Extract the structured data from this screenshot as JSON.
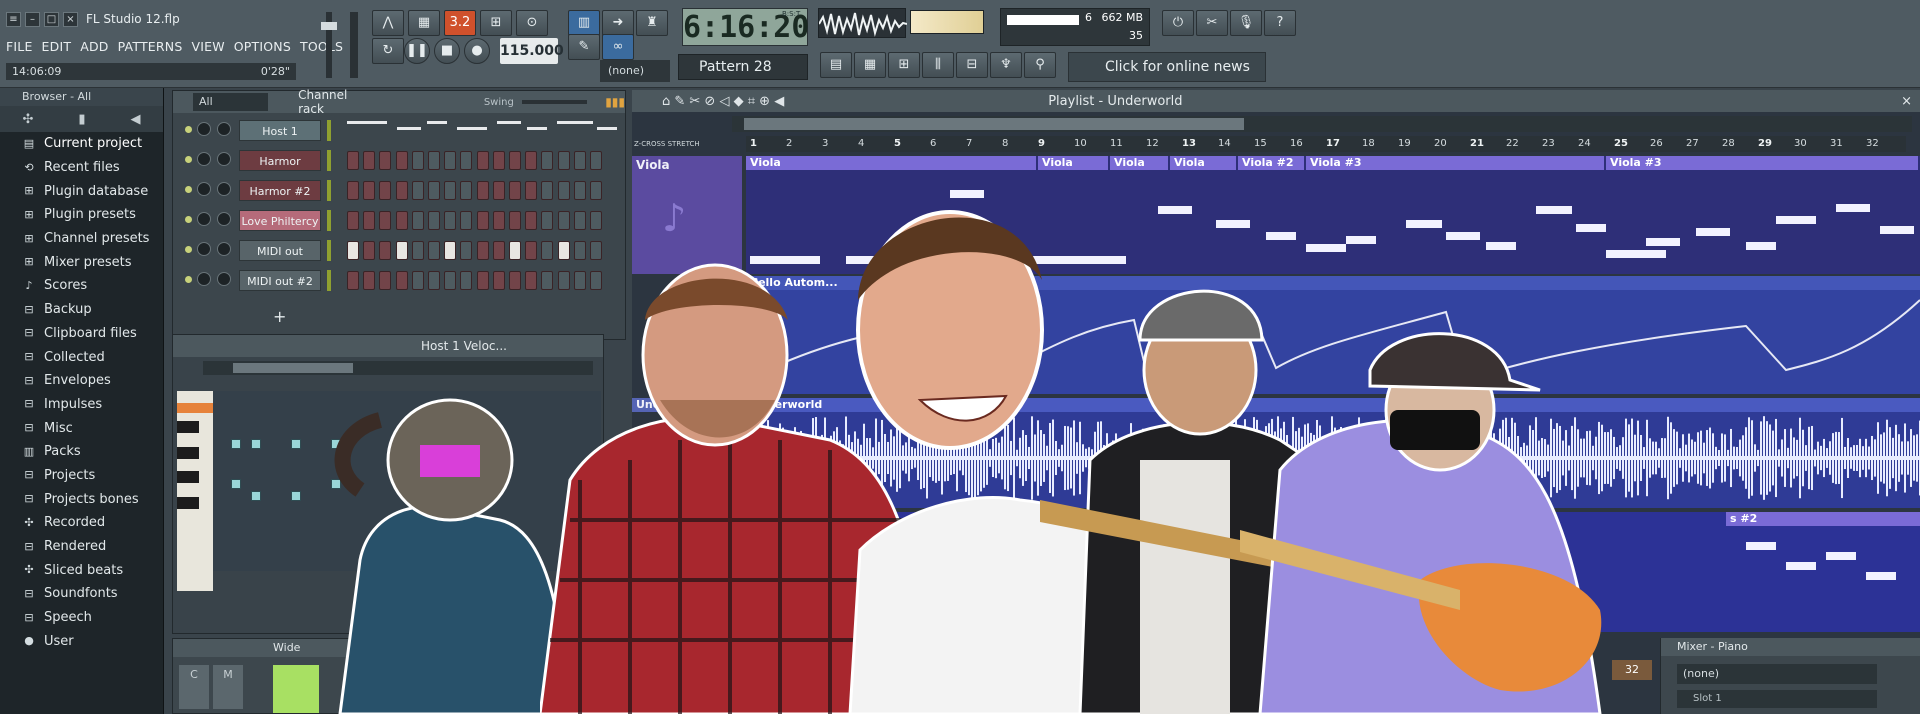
{
  "window": {
    "title": "FL Studio 12.flp"
  },
  "menu": [
    "FILE",
    "EDIT",
    "ADD",
    "PATTERNS",
    "VIEW",
    "OPTIONS",
    "TOOLS",
    "?"
  ],
  "status": {
    "time": "14:06:09",
    "position": "0'28\""
  },
  "transport": {
    "bpm": "115.000",
    "clock": "6:16:20",
    "clock_suffix": "B:S:T",
    "pattern": "Pattern 28",
    "snap": "(none)",
    "badge": "3.2"
  },
  "performance": {
    "cpu": "6",
    "memory": "662 MB",
    "polyphony": "35"
  },
  "news": {
    "label": "Click for online news"
  },
  "browser": {
    "title": "Browser - All",
    "items": [
      "Current project",
      "Recent files",
      "Plugin database",
      "Plugin presets",
      "Channel presets",
      "Mixer presets",
      "Scores",
      "Backup",
      "Clipboard files",
      "Collected",
      "Envelopes",
      "Impulses",
      "Misc",
      "Packs",
      "Projects",
      "Projects bones",
      "Recorded",
      "Rendered",
      "Sliced beats",
      "Soundfonts",
      "Speech",
      "User"
    ]
  },
  "channel_rack": {
    "filter": "All",
    "title": "Channel rack",
    "swing_label": "Swing",
    "channels": [
      {
        "name": "Host 1",
        "style": "piano"
      },
      {
        "name": "Harmor",
        "style": "red"
      },
      {
        "name": "Harmor #2",
        "style": "red"
      },
      {
        "name": "Love Philtercy",
        "style": "pink"
      },
      {
        "name": "MIDI out",
        "style": "gray"
      },
      {
        "name": "MIDI out #2",
        "style": "gray"
      }
    ]
  },
  "piano_roll": {
    "title": "Host 1  Veloc..."
  },
  "playlist": {
    "title": "Playlist - Underworld",
    "tool_labels": [
      "Z-CROSS",
      "STRETCH"
    ],
    "bars": [
      "1",
      "2",
      "3",
      "4",
      "5",
      "6",
      "7",
      "8",
      "9",
      "10",
      "11",
      "12",
      "13",
      "14",
      "15",
      "16",
      "17",
      "18",
      "19",
      "20",
      "21",
      "22",
      "23",
      "24",
      "25",
      "26",
      "27",
      "28",
      "29",
      "30",
      "31",
      "32"
    ],
    "tracks": [
      {
        "name": "Viola"
      },
      {
        "name": "Underworld"
      }
    ],
    "clips": [
      "Viola",
      "Viola",
      "Viola",
      "Viola",
      "Viola #2",
      "Viola #3",
      "Viola #3"
    ],
    "automation_clip": "Cello Autom...",
    "wave_clip": "Underworld",
    "partial_clip": "s #2"
  },
  "mixer_strip": {
    "label": "Wide",
    "channels": [
      "C",
      "M"
    ]
  },
  "mixer_piano": {
    "title": "Mixer - Piano",
    "input": "(none)",
    "slot": "Slot 1",
    "channel": "32"
  },
  "colors": {
    "accent": "#d0512c",
    "playlist_lane": "#2e2f78",
    "clip": "#7a6bd6",
    "display": "#8fa69a"
  }
}
